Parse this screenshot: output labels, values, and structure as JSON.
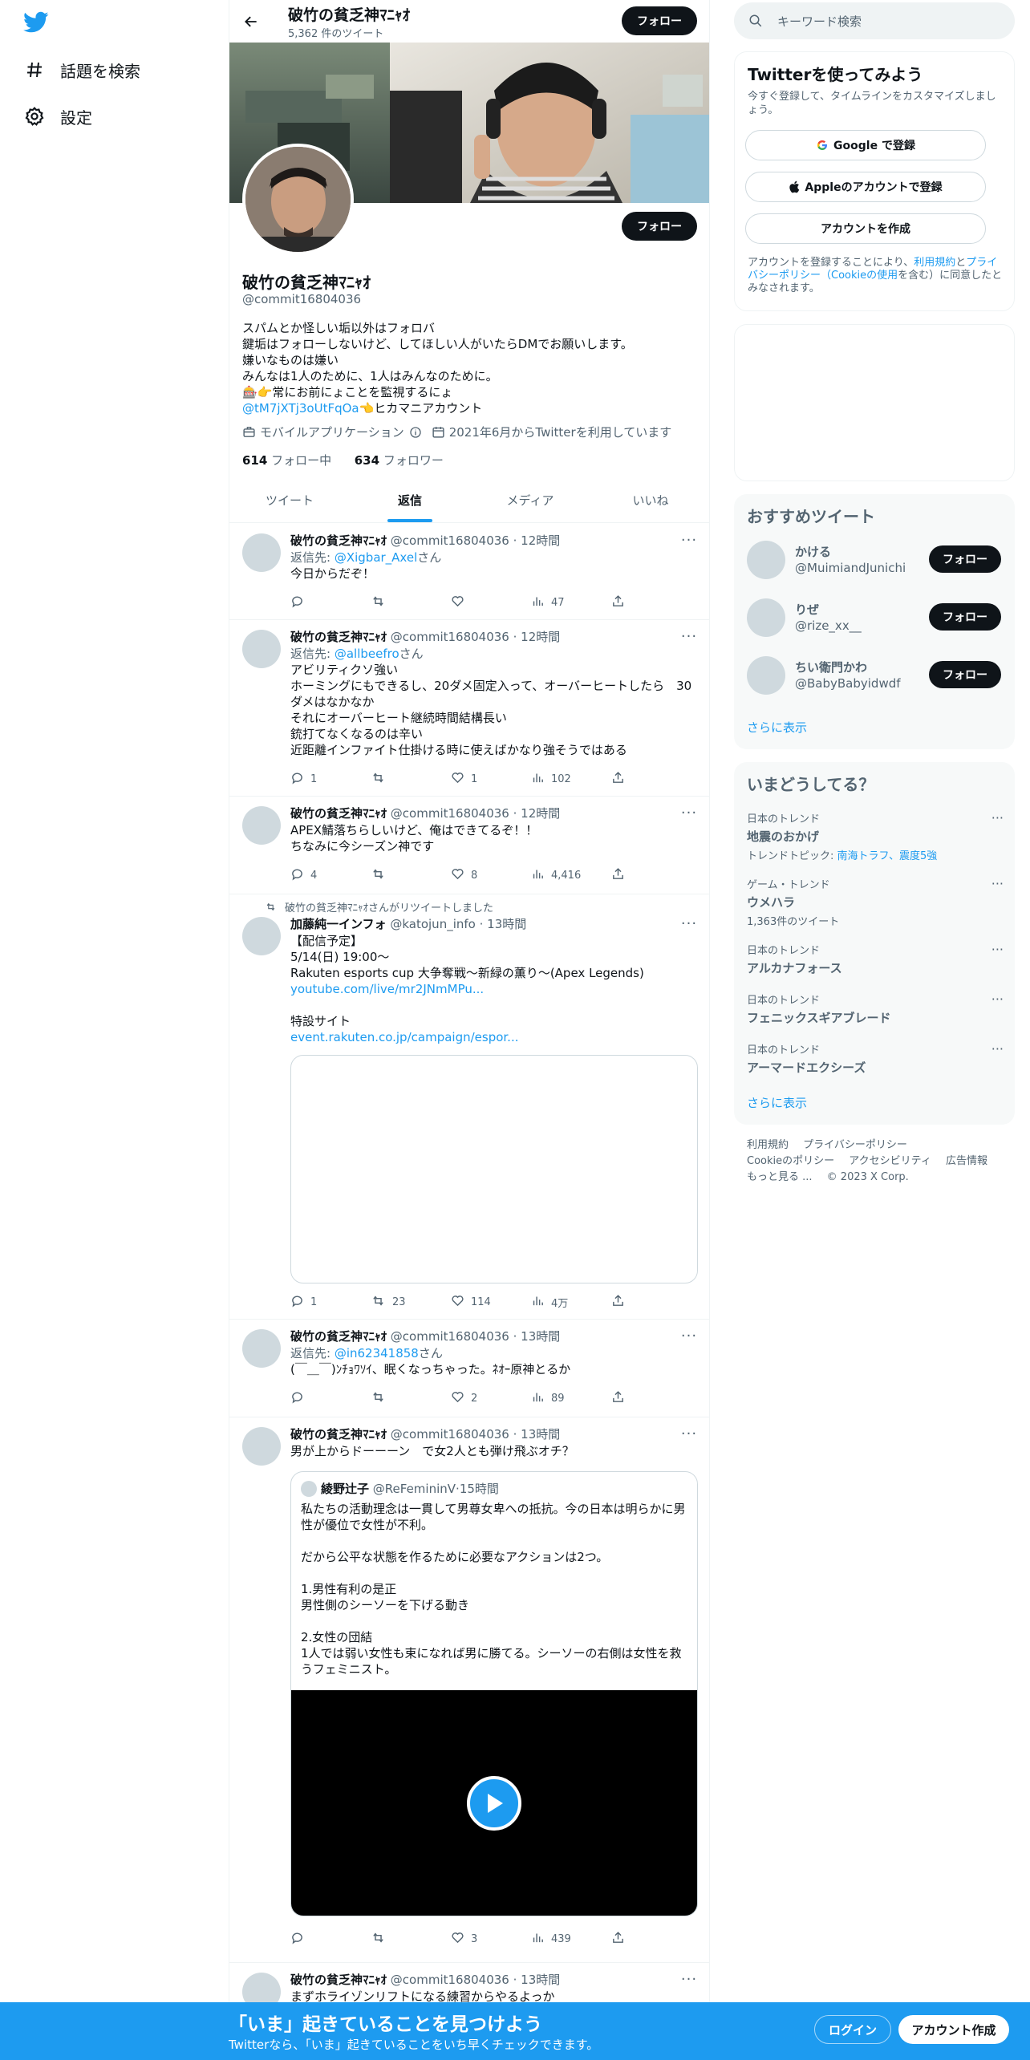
{
  "nav": {
    "explore": "話題を検索",
    "settings": "設定"
  },
  "topbar": {
    "name": "破竹の貧乏神ﾏﾆｬｵ",
    "tweet_count": "5,362 件のツイート",
    "follow": "フォロー"
  },
  "profile": {
    "follow": "フォロー",
    "name": "破竹の貧乏神ﾏﾆｬｵ",
    "handle": "@commit16804036",
    "bio": [
      "スパムとか怪しい垢以外はフォロバ",
      "鍵垢はフォローしないけど、してほしい人がいたらDMでお願いします。",
      "嫌いなものは嫌い",
      "みんなは1人のために、1人はみんなのために。",
      "🎰👉常にお前にょことを監視するにょ"
    ],
    "bio_link": "@tM7jXTj3oUtFqOa",
    "bio_link_tail": "👈ヒカマニアカウント",
    "app": "モバイルアプリケーション",
    "joined": "2021年6月からTwitterを利用しています",
    "following_count": "614",
    "following_label": "フォロー中",
    "followers_count": "634",
    "followers_label": "フォロワー"
  },
  "tabs": [
    "ツイート",
    "返信",
    "メディア",
    "いいね"
  ],
  "tweets": [
    {
      "name": "破竹の貧乏神ﾏﾆｬｵ",
      "handle": "@commit16804036",
      "time": "12時間",
      "reply_prefix": "返信先: ",
      "reply_to": "@Xigbar_Axel",
      "reply_suffix": "さん",
      "text": [
        "今日からだぞ！"
      ],
      "replies": "",
      "retweets": "",
      "likes": "",
      "views": "47"
    },
    {
      "name": "破竹の貧乏神ﾏﾆｬｵ",
      "handle": "@commit16804036",
      "time": "12時間",
      "reply_prefix": "返信先: ",
      "reply_to": "@allbeefro",
      "reply_suffix": "さん",
      "text": [
        "アビリティクソ強い",
        "ホーミングにもできるし、20ダメ固定入って、オーバーヒートしたら　30ダメはなかなか",
        "それにオーバーヒート継続時間結構長い",
        "銃打てなくなるのは辛い",
        "近距離インファイト仕掛ける時に使えばかなり強そうではある"
      ],
      "replies": "1",
      "retweets": "",
      "likes": "1",
      "views": "102"
    },
    {
      "name": "破竹の貧乏神ﾏﾆｬｵ",
      "handle": "@commit16804036",
      "time": "12時間",
      "text": [
        "APEX鯖落ちらしいけど、俺はできてるぞ！！",
        "ちなみに今シーズン神です"
      ],
      "replies": "4",
      "retweets": "",
      "likes": "8",
      "views": "4,416"
    },
    {
      "retweeted_by": "破竹の貧乏神ﾏﾆｬｵさんがリツイートしました",
      "name": "加藤純一インフォ",
      "handle": "@katojun_info",
      "time": "13時間",
      "text": [
        "【配信予定】",
        "5/14(日) 19:00～",
        "Rakuten esports cup 大争奪戦〜新緑の薫り〜(Apex Legends)"
      ],
      "link1": "youtube.com/live/mr2JNmMPu...",
      "text2": "特設サイト",
      "link2": "event.rakuten.co.jp/campaign/espor...",
      "replies": "1",
      "retweets": "23",
      "likes": "114",
      "views": "4万"
    },
    {
      "name": "破竹の貧乏神ﾏﾆｬｵ",
      "handle": "@commit16804036",
      "time": "13時間",
      "reply_prefix": "返信先: ",
      "reply_to": "@in62341858",
      "reply_suffix": "さん",
      "text": [
        "(￣＿￣)ﾝﾁｮﾜｿｲ、眠くなっちゃった。ﾈｵｰ原神とるか"
      ],
      "replies": "",
      "retweets": "",
      "likes": "2",
      "views": "89"
    },
    {
      "name": "破竹の貧乏神ﾏﾆｬｵ",
      "handle": "@commit16804036",
      "time": "13時間",
      "text": [
        "男が上からドーーーン　で女2人とも弾け飛ぶオチ？"
      ],
      "quote": {
        "name": "綾野辻子",
        "handle": "@ReFemininV",
        "time": "15時間",
        "text": [
          "私たちの活動理念は一貫して男尊女卑への抵抗。今の日本は明らかに男性が優位で女性が不利。",
          "",
          "だから公平な状態を作るために必要なアクションは2つ。",
          "",
          "1.男性有利の是正",
          "男性側のシーソーを下げる動き",
          "",
          "2.女性の団結",
          "1人では弱い女性も束になれば男に勝てる。シーソーの右側は女性を救うフェミニスト。"
        ]
      },
      "replies": "",
      "retweets": "",
      "likes": "3",
      "views": "439"
    },
    {
      "name": "破竹の貧乏神ﾏﾆｬｵ",
      "handle": "@commit16804036",
      "time": "13時間",
      "text": [
        "まずホライゾンリフトになる練習からやるよっか"
      ]
    }
  ],
  "right": {
    "search_placeholder": "キーワード検索",
    "signup": {
      "title": "Twitterを使ってみよう",
      "sub": "今すぐ登録して、タイムラインをカスタマイズしましょう。",
      "google": "Google で登録",
      "apple": "Appleのアカウントで登録",
      "create": "アカウントを作成",
      "terms_pre": "アカウントを登録することにより、",
      "terms_link1": "利用規約",
      "terms_and": "と",
      "terms_link2": "プライバシーポリシー（Cookieの使用",
      "terms_post": "を含む）に同意したとみなされます。"
    },
    "recommend": {
      "title": "おすすめツイート",
      "users": [
        {
          "name": "かける",
          "handle": "@MuimiandJunichi"
        },
        {
          "name": "りぜ",
          "handle": "@rize_xx__"
        },
        {
          "name": "ちい衛門かわ",
          "handle": "@BabyBabyidwdf"
        }
      ],
      "follow": "フォロー",
      "more": "さらに表示"
    },
    "trends": {
      "title": "いまどうしてる？",
      "items": [
        {
          "ctx": "日本のトレンド",
          "title": "地震のおかげ",
          "sub_pre": "トレンドトピック: ",
          "sub_link": "南海トラフ、震度5強"
        },
        {
          "ctx": "ゲーム・トレンド",
          "title": "ウメハラ",
          "sub": "1,363件のツイート"
        },
        {
          "ctx": "日本のトレンド",
          "title": "アルカナフォース"
        },
        {
          "ctx": "日本のトレンド",
          "title": "フェニックスギアブレード"
        },
        {
          "ctx": "日本のトレンド",
          "title": "アーマードエクシーズ"
        }
      ],
      "more": "さらに表示"
    },
    "footer": [
      "利用規約",
      "プライバシーポリシー",
      "Cookieのポリシー",
      "アクセシビリティ",
      "広告情報",
      "もっと見る ...",
      "© 2023 X Corp."
    ]
  },
  "bottom": {
    "title": "「いま」起きていることを見つけよう",
    "sub": "Twitterなら、「いま」起きていることをいち早くチェックできます。",
    "login": "ログイン",
    "signup": "アカウント作成"
  }
}
